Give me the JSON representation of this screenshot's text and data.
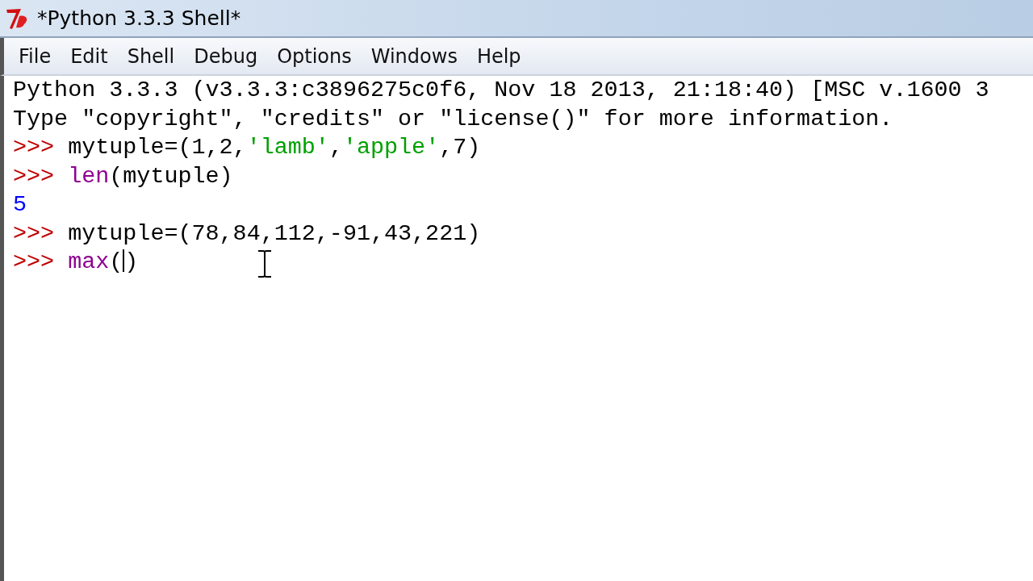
{
  "window": {
    "title": "*Python 3.3.3 Shell*"
  },
  "menu": [
    "File",
    "Edit",
    "Shell",
    "Debug",
    "Options",
    "Windows",
    "Help"
  ],
  "lines": [
    [
      {
        "kind": "output",
        "text": "Python 3.3.3 (v3.3.3:c3896275c0f6, Nov 18 2013, 21:18:40) [MSC v.1600 3"
      }
    ],
    [
      {
        "kind": "output",
        "text": "Type \"copyright\", \"credits\" or \"license()\" for more information."
      }
    ],
    [
      {
        "kind": "prompt",
        "text": ">>> "
      },
      {
        "kind": "code",
        "text": "mytuple=(1,2,"
      },
      {
        "kind": "string",
        "text": "'lamb'"
      },
      {
        "kind": "code",
        "text": ","
      },
      {
        "kind": "string",
        "text": "'apple'"
      },
      {
        "kind": "code",
        "text": ",7)"
      }
    ],
    [
      {
        "kind": "prompt",
        "text": ">>> "
      },
      {
        "kind": "builtin",
        "text": "len"
      },
      {
        "kind": "code",
        "text": "(mytuple)"
      }
    ],
    [
      {
        "kind": "result",
        "text": "5"
      }
    ],
    [
      {
        "kind": "prompt",
        "text": ">>> "
      },
      {
        "kind": "code",
        "text": "mytuple=(78,84,112,-91,43,221)"
      }
    ],
    [
      {
        "kind": "prompt",
        "text": ">>> "
      },
      {
        "kind": "builtin",
        "text": "max"
      },
      {
        "kind": "code",
        "text": "("
      },
      {
        "kind": "caret"
      },
      {
        "kind": "code",
        "text": ")"
      }
    ]
  ]
}
